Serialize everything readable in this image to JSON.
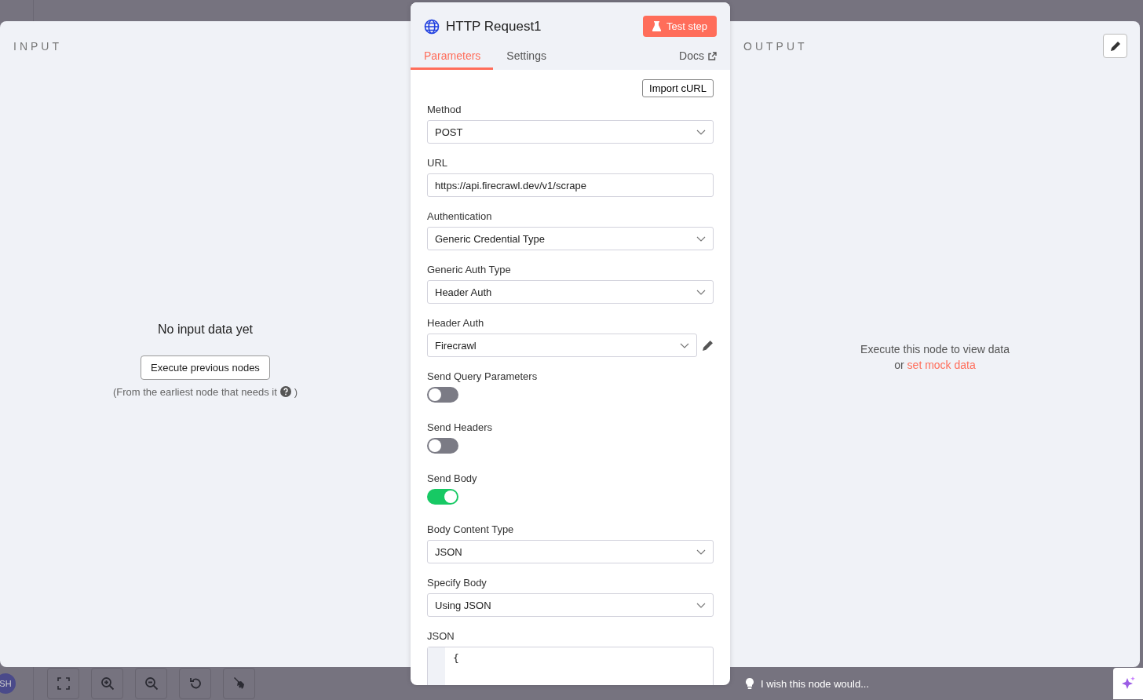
{
  "input_pane": {
    "title": "INPUT",
    "empty_title": "No input data yet",
    "button": "Execute previous nodes",
    "hint_open": "(From the earliest node that needs it",
    "hint_close": ")"
  },
  "output_pane": {
    "title": "OUTPUT",
    "message": "Execute this node to view data",
    "message_prefix": "or",
    "link": "set mock data"
  },
  "node": {
    "title": "HTTP Request1",
    "test_button": "Test step",
    "tabs": [
      {
        "label": "Parameters",
        "selected": true
      },
      {
        "label": "Settings",
        "selected": false
      }
    ],
    "docs_link": "Docs",
    "import_button": "Import cURL",
    "fields": [
      {
        "kind": "select",
        "label": "Method",
        "value": "POST"
      },
      {
        "kind": "input",
        "label": "URL",
        "value": "https://api.firecrawl.dev/v1/scrape"
      },
      {
        "kind": "select",
        "label": "Authentication",
        "value": "Generic Credential Type"
      },
      {
        "kind": "select",
        "label": "Generic Auth Type",
        "value": "Header Auth"
      },
      {
        "kind": "credential",
        "label": "Header Auth",
        "value": "Firecrawl"
      },
      {
        "kind": "toggle",
        "label": "Send Query Parameters",
        "on": false
      },
      {
        "kind": "toggle",
        "label": "Send Headers",
        "on": false
      },
      {
        "kind": "toggle",
        "label": "Send Body",
        "on": true
      },
      {
        "kind": "select",
        "label": "Body Content Type",
        "value": "JSON"
      },
      {
        "kind": "select",
        "label": "Specify Body",
        "value": "Using JSON"
      },
      {
        "kind": "code",
        "label": "JSON",
        "value": "{"
      }
    ]
  },
  "canvas_toolbar": {
    "avatar": "SH",
    "ask_prompt": "I wish this node would..."
  }
}
